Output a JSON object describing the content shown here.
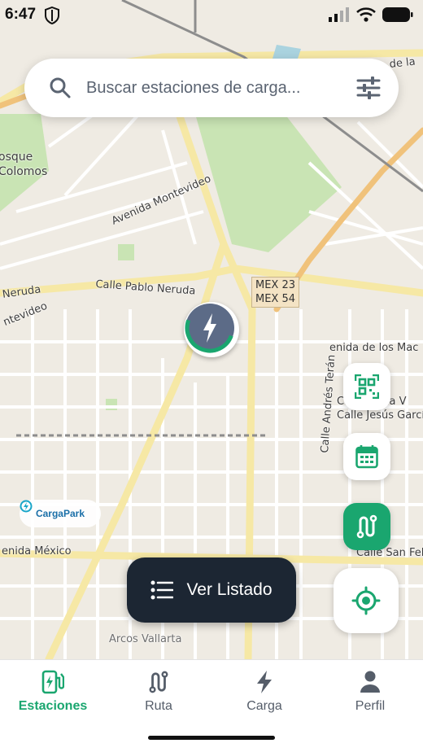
{
  "status_bar": {
    "time": "6:47"
  },
  "search": {
    "placeholder": "Buscar estaciones de carga..."
  },
  "map": {
    "labels": {
      "bosque_1": "osque",
      "bosque_2": "Colomos",
      "avenida_montevideo": "Avenida Montevideo",
      "calle_pablo_neruda": "Calle Pablo Neruda",
      "neruda": "Neruda",
      "montevideo_left": "ntevideo",
      "de_la": "de la",
      "de_los_mac": "enida de los Mac",
      "calle_maria": "Calle María V",
      "calle_jesus": "Calle Jesús Garcí",
      "calle_andres_teran": "Calle Andrés Terán",
      "avenida_mexico": "enida México",
      "calle_san_feli": "Calle San Feli",
      "arcos_vallarta": "Arcos Vallarta"
    },
    "shield": {
      "line1": "MEX 23",
      "line2": "MEX 54"
    },
    "attribution": "CargaPark"
  },
  "actions": {
    "list_button": "Ver Listado"
  },
  "colors": {
    "accent": "#1aa66f",
    "dark": "#1c2633",
    "marker": "#5c6b87"
  },
  "bottom_nav": [
    {
      "label": "Estaciones",
      "icon": "charging-station-icon",
      "active": true
    },
    {
      "label": "Ruta",
      "icon": "route-icon",
      "active": false
    },
    {
      "label": "Carga",
      "icon": "bolt-icon",
      "active": false
    },
    {
      "label": "Perfil",
      "icon": "user-icon",
      "active": false
    }
  ]
}
